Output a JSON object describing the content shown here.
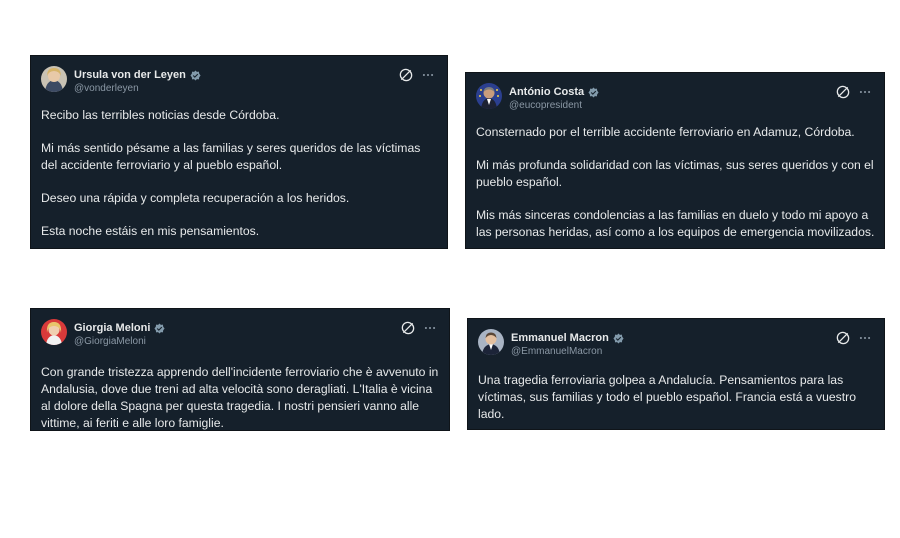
{
  "tweets": [
    {
      "name": "Ursula von der Leyen",
      "handle": "@vonderleyen",
      "paragraphs": [
        "Recibo las terribles noticias desde Córdoba.",
        "Mi más sentido pésame a las familias y seres queridos de las víctimas del accidente ferroviario y al pueblo español.",
        "Deseo una rápida y completa recuperación a los heridos.",
        "Esta noche estáis en mis pensamientos."
      ]
    },
    {
      "name": "António Costa",
      "handle": "@eucopresident",
      "paragraphs": [
        "Consternado por el terrible accidente ferroviario en Adamuz, Córdoba.",
        "Mi más profunda solidaridad con las víctimas, sus seres queridos y con el pueblo español.",
        "Mis más sinceras condolencias a las familias en duelo y todo mi apoyo a las personas heridas, así como a los equipos de emergencia movilizados."
      ]
    },
    {
      "name": "Giorgia Meloni",
      "handle": "@GiorgiaMeloni",
      "paragraphs": [
        "Con grande tristezza apprendo dell'incidente ferroviario che è avvenuto in Andalusia, dove due treni ad alta velocità sono deragliati. L'Italia è vicina al dolore della Spagna per questa tragedia. I nostri pensieri vanno alle vittime, ai feriti e alle loro famiglie."
      ]
    },
    {
      "name": "Emmanuel Macron",
      "handle": "@EmmanuelMacron",
      "paragraphs": [
        "Una tragedia ferroviaria golpea a Andalucía. Pensamientos para las víctimas, sus familias y todo el pueblo español. Francia está a vuestro lado."
      ]
    }
  ],
  "icons": {
    "verified": "verified-badge-icon",
    "grok": "grok-icon",
    "more": "more-options-icon"
  },
  "colors": {
    "card_background": "#15202b",
    "text": "#e7e9ea",
    "handle": "#8b98a5",
    "verified_badge": "#829aab"
  }
}
